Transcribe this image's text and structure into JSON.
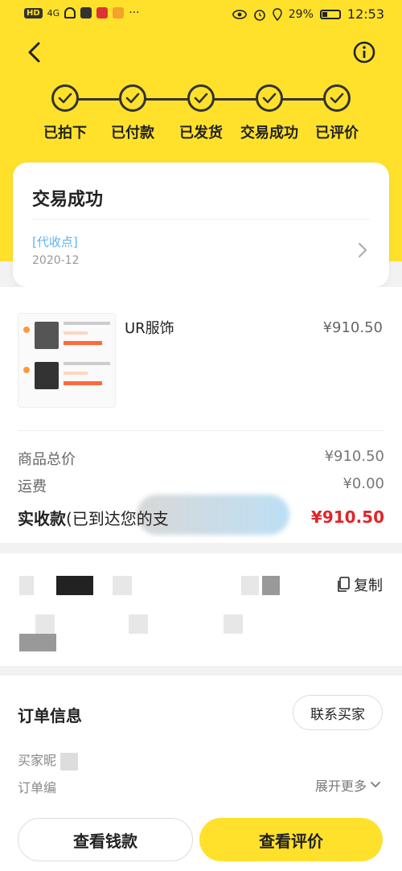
{
  "status_bar": {
    "left_badge": "HD",
    "left_sig": "4G",
    "left_dots": "···",
    "battery_percent": "29%",
    "time": "12:53"
  },
  "icons": {
    "back": "back-chevron-icon",
    "info": "info-icon",
    "check": "check-icon",
    "chevron_right": "chevron-right-icon",
    "copy": "copy-icon",
    "chevron_down": "chevron-down-icon"
  },
  "steps": [
    {
      "label": "已拍下"
    },
    {
      "label": "已付款"
    },
    {
      "label": "已发货"
    },
    {
      "label": "交易成功"
    },
    {
      "label": "已评价"
    }
  ],
  "status_card": {
    "title": "交易成功",
    "logistics_text": "[代收点]",
    "logistics_date": "2020-12"
  },
  "product": {
    "shop_name": "UR服饰",
    "price": "¥910.50"
  },
  "summary": {
    "goods_label": "商品总价",
    "goods_value": "¥910.50",
    "shipping_label": "运费",
    "shipping_value": "¥0.00",
    "actual_label": "实收款",
    "actual_note": "(已到达您的支",
    "actual_value": "¥910.50"
  },
  "address": {
    "copy_label": "复制"
  },
  "order_info": {
    "title": "订单信息",
    "contact_buyer": "联系买家",
    "buyer_nick_label": "买家昵",
    "order_no_label": "订单编",
    "expand_label": "展开更多"
  },
  "buttons": {
    "view_payment": "查看钱款",
    "view_review": "查看评价"
  },
  "colors": {
    "brand_yellow": "#ffe12c",
    "price_red": "#e0252a",
    "logistics_blue": "#5cb3f1"
  }
}
